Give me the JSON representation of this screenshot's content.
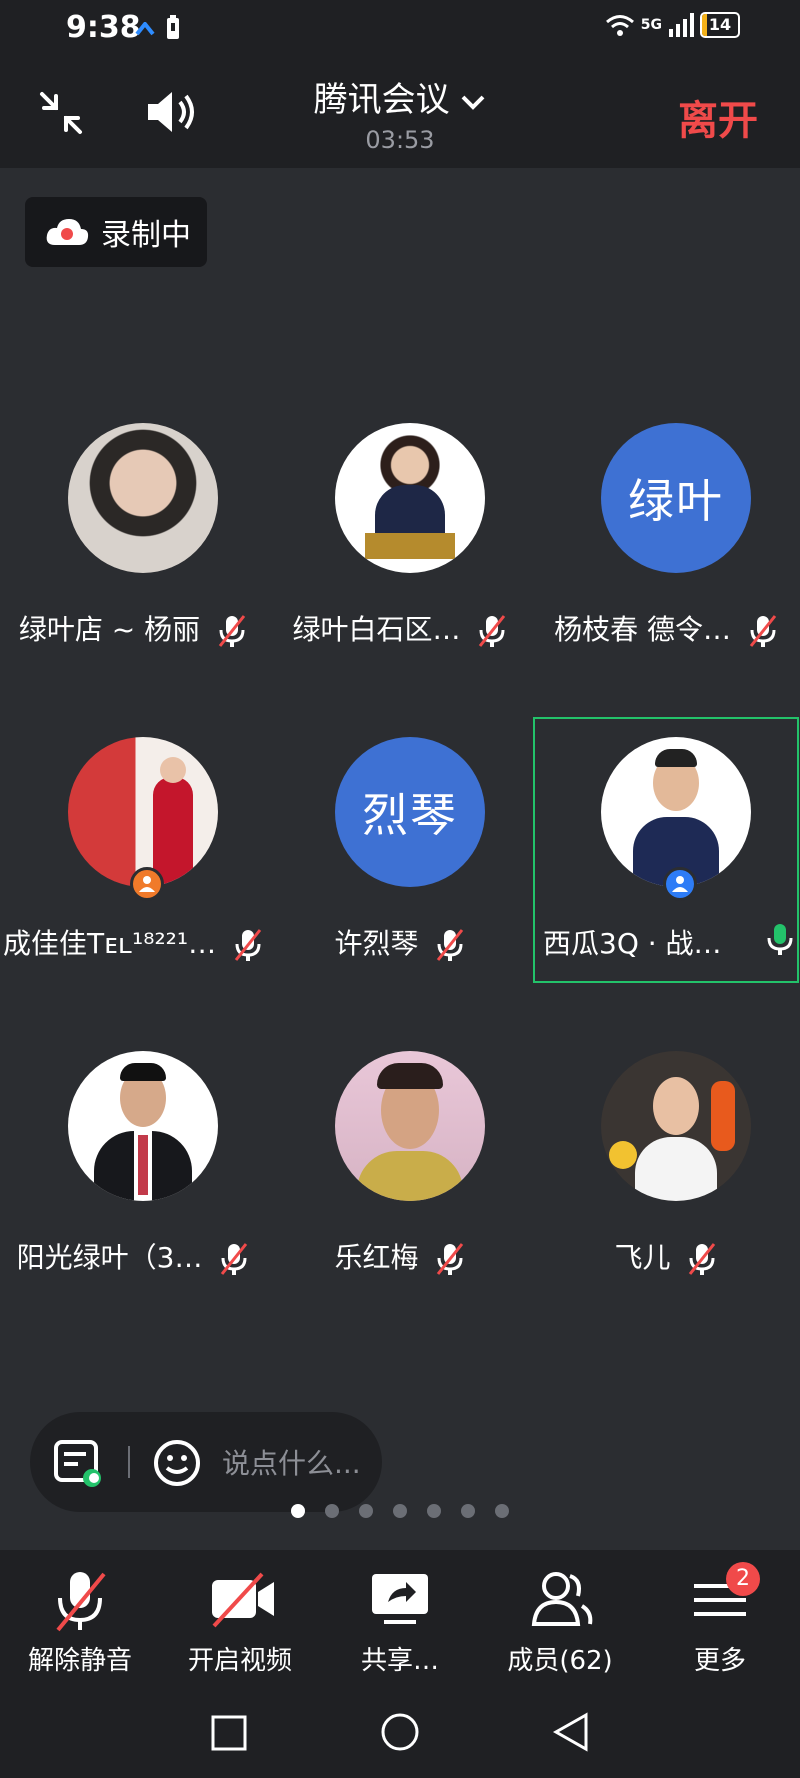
{
  "status_bar": {
    "time": "9:38",
    "network": "5G",
    "battery": "14"
  },
  "header": {
    "title": "腾讯会议",
    "timer": "03:53",
    "leave_label": "离开"
  },
  "recording": {
    "label": "录制中"
  },
  "participants": [
    {
      "name": "绿叶店 ~ 杨丽",
      "mic": "muted"
    },
    {
      "name": "绿叶白石区…",
      "mic": "muted"
    },
    {
      "name": "杨枝春  德令…",
      "initials": "绿叶",
      "mic": "muted"
    },
    {
      "name": "成佳佳Tᴇʟ¹⁸²²¹…",
      "mic": "muted"
    },
    {
      "name": "许烈琴",
      "initials": "烈琴",
      "mic": "muted"
    },
    {
      "name": "西瓜3Q · 战…",
      "mic": "active"
    },
    {
      "name": "阳光绿叶（3…",
      "mic": "muted"
    },
    {
      "name": "乐红梅",
      "mic": "muted"
    },
    {
      "name": "飞儿",
      "mic": "muted"
    }
  ],
  "chat": {
    "placeholder": "说点什么..."
  },
  "toolbar": {
    "unmute": "解除静音",
    "video": "开启视频",
    "share": "共享…",
    "members": "成员(62)",
    "more": "更多",
    "more_badge": "2"
  },
  "colors": {
    "accent_green": "#23c26a",
    "leave_red": "#f04a4a",
    "avatar_blue": "#3e71d3"
  }
}
